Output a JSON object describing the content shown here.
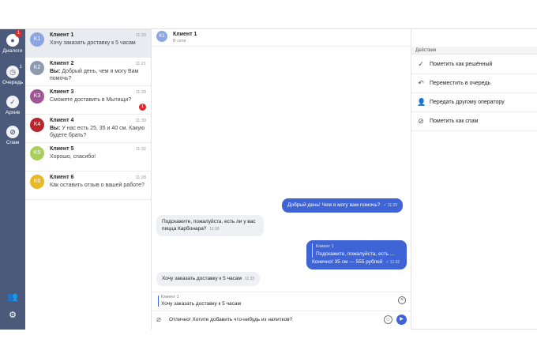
{
  "rail": {
    "items": [
      {
        "label": "Диалоги",
        "badge": "1",
        "icon": "chat-icon"
      },
      {
        "label": "Очередь",
        "count": "1",
        "icon": "clock-icon"
      },
      {
        "label": "Архив",
        "icon": "check-circle-icon"
      },
      {
        "label": "Спам",
        "icon": "block-icon"
      }
    ],
    "bottom": [
      {
        "icon": "users-icon",
        "glyph": "👥"
      },
      {
        "icon": "gear-icon",
        "glyph": "⚙"
      }
    ]
  },
  "chats": [
    {
      "avatar": "K1",
      "color": "#8aa6e3",
      "name": "Клиент 1",
      "time": "11:33",
      "prefix": "",
      "preview": "Хочу заказать доставку к 5 часам",
      "badge": ""
    },
    {
      "avatar": "K2",
      "color": "#8e9ab2",
      "name": "Клиент 2",
      "time": "11:21",
      "prefix": "Вы:",
      "preview": "Добрый день, чем я могу Вам помочь?",
      "badge": ""
    },
    {
      "avatar": "K3",
      "color": "#a05696",
      "name": "Клиент 3",
      "time": "11:29",
      "prefix": "",
      "preview": "Сможете доставить в Мытищи?",
      "badge": "1"
    },
    {
      "avatar": "K4",
      "color": "#b8262d",
      "name": "Клиент 4",
      "time": "11:30",
      "prefix": "Вы:",
      "preview": "У нас есть 25, 35 и 40 см. Какую будете брать?",
      "badge": ""
    },
    {
      "avatar": "K5",
      "color": "#a9cf5a",
      "name": "Клиент 5",
      "time": "11:32",
      "prefix": "",
      "preview": "Хорошо, спасибо!",
      "badge": ""
    },
    {
      "avatar": "K6",
      "color": "#e8b923",
      "name": "Клиент 6",
      "time": "11:28",
      "prefix": "",
      "preview": "Как оставить отзыв о вашей работе?",
      "badge": ""
    }
  ],
  "conversation": {
    "avatar": "K1",
    "title": "Клиент 1",
    "status": "В сети",
    "messages": [
      {
        "text": "Добрый день! Чем я могу вам помочь?",
        "time": "✓ 11:29"
      },
      {
        "text": "Подскажите, пожалуйста, есть ли у вас пицца Карбонара?",
        "time": "11:30"
      },
      {
        "quote_name": "Клиент 1",
        "quote_text": "Подскажите, пожалуйста, есть ...",
        "text": "Конечно! 35 см — 555 рублей",
        "time": "✓ 11:32"
      },
      {
        "text": "Хочу заказать доставку к 5 часам",
        "time": "11:33"
      }
    ],
    "reply": {
      "name": "Клиент 1",
      "text": "Хочу заказать доставку к 5 часам"
    },
    "input_value": "Отлично! Хотите добавить что-нибудь из напитков?"
  },
  "actions": {
    "header": "Действия",
    "items": [
      {
        "label": "Пометить как решённый",
        "icon": "check-icon",
        "glyph": "✓"
      },
      {
        "label": "Переместить в очередь",
        "icon": "back-arrow-icon",
        "glyph": "↶"
      },
      {
        "label": "Передать другому оператору",
        "icon": "user-icon",
        "glyph": "👤"
      },
      {
        "label": "Пометить как спам",
        "icon": "block-icon",
        "glyph": "⊘"
      }
    ]
  }
}
